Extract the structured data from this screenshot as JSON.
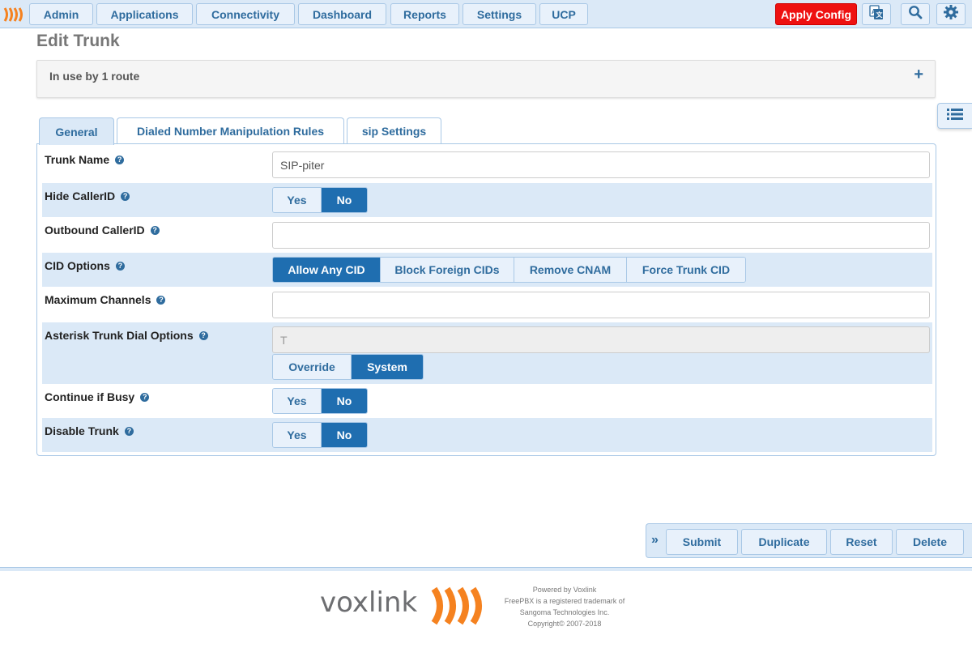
{
  "nav": {
    "logo_icon": "freepbx-logo-icon",
    "items": [
      {
        "label": "Admin"
      },
      {
        "label": "Applications"
      },
      {
        "label": "Connectivity"
      },
      {
        "label": "Dashboard"
      },
      {
        "label": "Reports"
      },
      {
        "label": "Settings"
      },
      {
        "label": "UCP"
      }
    ],
    "apply_config": "Apply Config",
    "icons": [
      "language-icon",
      "search-icon",
      "gear-icon"
    ]
  },
  "page": {
    "title": "Edit Trunk",
    "usage_text": "In use by 1 route",
    "expand_symbol": "+"
  },
  "tabs": [
    {
      "label": "General",
      "active": true
    },
    {
      "label": "Dialed Number Manipulation Rules",
      "active": false
    },
    {
      "label": "sip Settings",
      "active": false
    }
  ],
  "form": {
    "help_symbol": "?",
    "trunk_name": {
      "label": "Trunk Name",
      "value": "SIP-piter"
    },
    "hide_callerid": {
      "label": "Hide CallerID",
      "yes": "Yes",
      "no": "No",
      "selected": "No"
    },
    "outbound_callerid": {
      "label": "Outbound CallerID",
      "value": ""
    },
    "cid_options": {
      "label": "CID Options",
      "options": [
        "Allow Any CID",
        "Block Foreign CIDs",
        "Remove CNAM",
        "Force Trunk CID"
      ],
      "selected": "Allow Any CID"
    },
    "max_channels": {
      "label": "Maximum Channels",
      "value": ""
    },
    "dial_options": {
      "label": "Asterisk Trunk Dial Options",
      "value": "T",
      "override": "Override",
      "system": "System",
      "selected": "System"
    },
    "continue_if_busy": {
      "label": "Continue if Busy",
      "yes": "Yes",
      "no": "No",
      "selected": "No"
    },
    "disable_trunk": {
      "label": "Disable Trunk",
      "yes": "Yes",
      "no": "No",
      "selected": "No"
    }
  },
  "actions": {
    "collapse_symbol": "»",
    "submit": "Submit",
    "duplicate": "Duplicate",
    "reset": "Reset",
    "delete": "Delete"
  },
  "footer": {
    "brand": "voxlink",
    "powered_by": "Powered by Voxlink",
    "trademark": "FreePBX is a registered trademark of",
    "company": "Sangoma Technologies Inc.",
    "copyright": "Copyright© 2007-2018"
  },
  "colors": {
    "accent": "#2f6c9e",
    "selected": "#1f6eb0",
    "nav_bg": "#dbe9f7",
    "apply": "#ee1111",
    "brand_orange": "#f58220"
  }
}
